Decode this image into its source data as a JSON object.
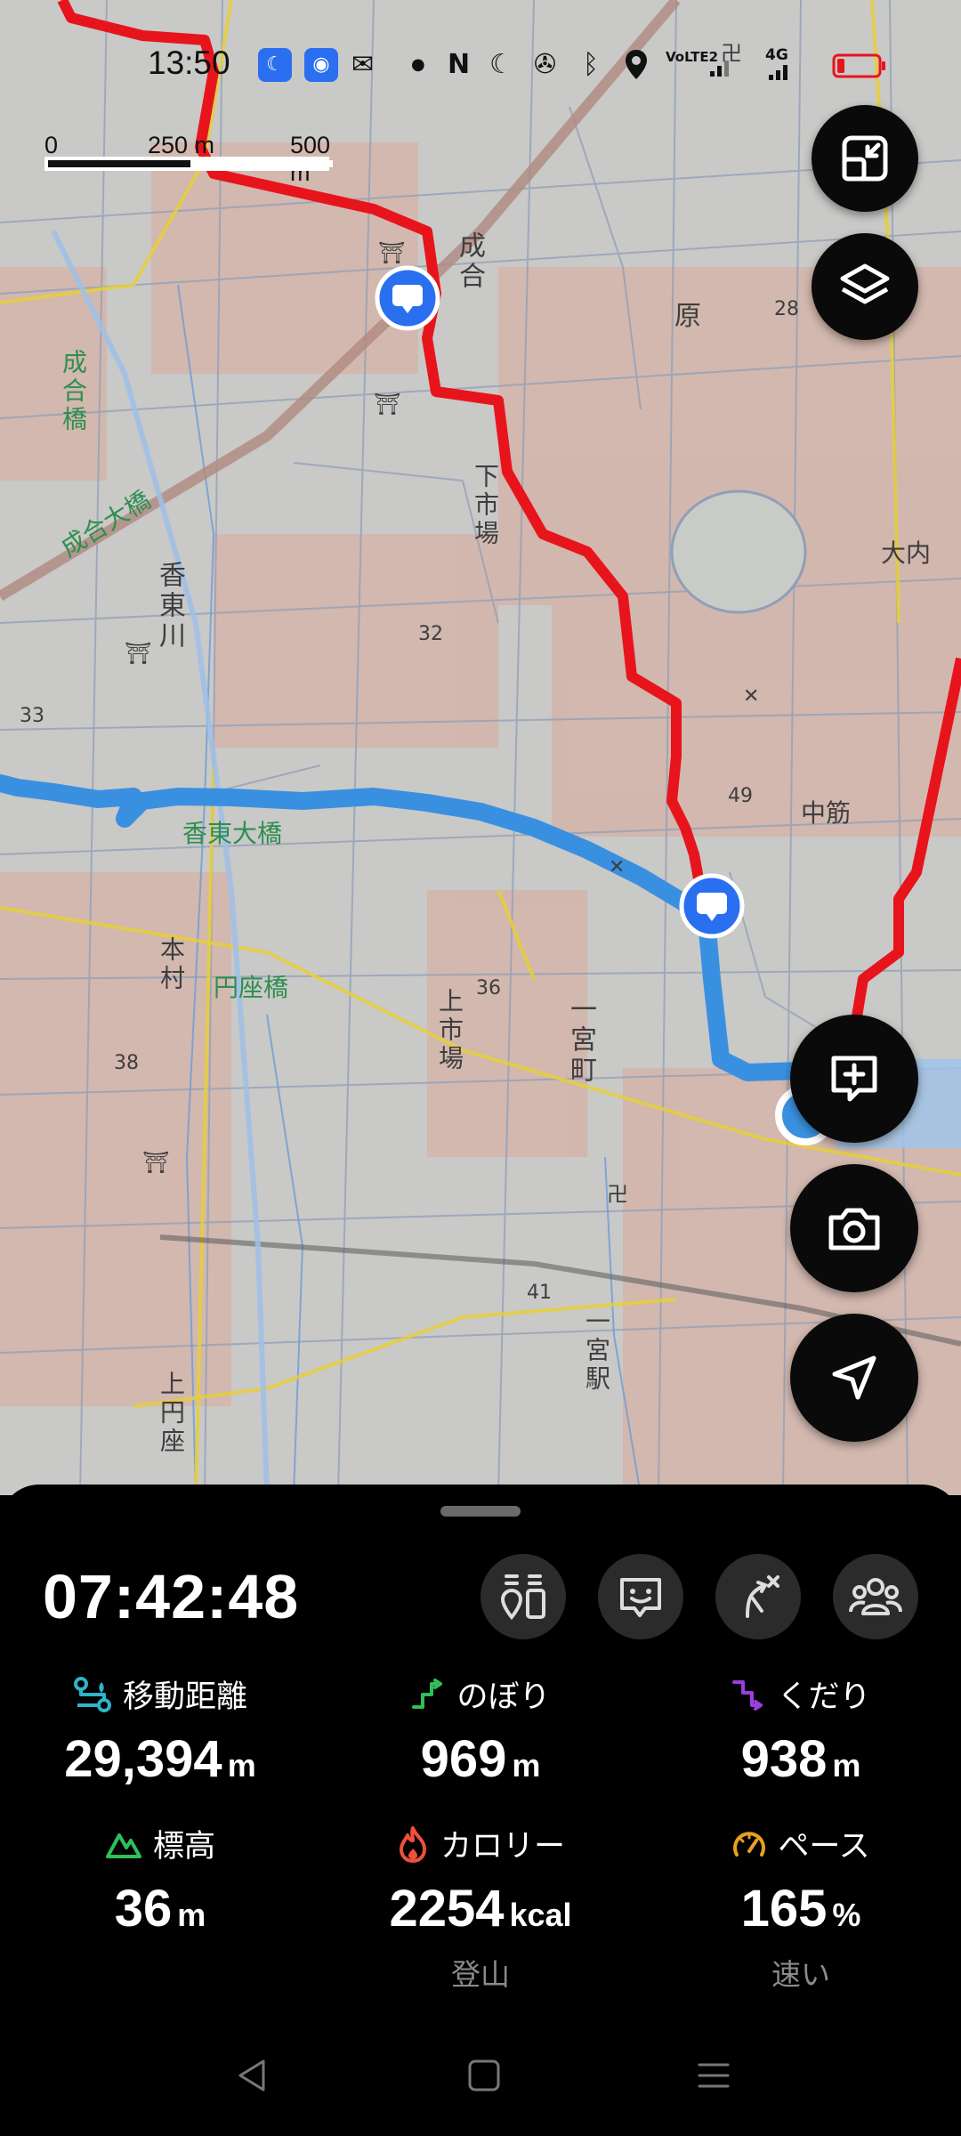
{
  "status_bar": {
    "time": "13:50",
    "icons": [
      "moon-badge-icon",
      "hotspot-badge-icon",
      "mail-icon",
      "dot-icon",
      "nfc-icon",
      "dnd-moon-icon",
      "mute-vibrate-icon",
      "bluetooth-icon",
      "location-icon",
      "volte-icon",
      "signal-icon",
      "4g-signal-icon",
      "battery-low-icon"
    ],
    "volte_label": "VoLTE2",
    "network_label": "4G"
  },
  "scale_bar": {
    "labels": [
      "0",
      "250 m",
      "500 m"
    ]
  },
  "map": {
    "labels": {
      "seigo": "成合",
      "hara": "原",
      "n28": "28",
      "seigo_bashi": "成合橋",
      "seigo_ohashi": "成合大橋",
      "shimo_ichiba": "下市場",
      "kotohigashigawa": "香東川",
      "n32": "32",
      "n33": "33",
      "kotohigashi_ohashi": "香東大橋",
      "n49": "49",
      "nakasuji": "中筋",
      "ouchi": "大内",
      "motomura": "本村",
      "enza_bashi": "円座橋",
      "n36": "36",
      "kami_ichiba": "上市場",
      "ichinomiya_cho": "一宮町",
      "n38": "38",
      "n41": "41",
      "ichinomiya_eki": "一宮駅",
      "kami_enza": "上円座",
      "shrine": "⛩",
      "temple": "卍",
      "hall": "✕"
    }
  },
  "buttons": {
    "exit_fullscreen": "exit-fullscreen",
    "layers": "layers",
    "add_note": "add-note",
    "camera": "camera",
    "navigate": "navigate"
  },
  "panel": {
    "elapsed_time": "07:42:48",
    "tools": [
      "checkpoint-tool",
      "emotion-tool",
      "route-tool",
      "group-tool"
    ],
    "stats": [
      {
        "label": "移動距離",
        "value": "29,394",
        "unit": "m",
        "sub": ""
      },
      {
        "label": "のぼり",
        "value": "969",
        "unit": "m",
        "sub": ""
      },
      {
        "label": "くだり",
        "value": "938",
        "unit": "m",
        "sub": ""
      },
      {
        "label": "標高",
        "value": "36",
        "unit": "m",
        "sub": ""
      },
      {
        "label": "カロリー",
        "value": "2254",
        "unit": "kcal",
        "sub": "登山"
      },
      {
        "label": "ペース",
        "value": "165",
        "unit": "%",
        "sub": "速い"
      }
    ]
  },
  "colors": {
    "route_red": "#e8141c",
    "route_blue": "#3a90e0",
    "fab_black": "#0a0a0a",
    "distance_icon": "#2fb3c8",
    "climb_icon": "#2fbf5a",
    "descent_icon": "#9b3fe0",
    "elevation_icon": "#2fbf5a",
    "calorie_icon": "#f0503c",
    "pace_icon": "#e8a020"
  }
}
